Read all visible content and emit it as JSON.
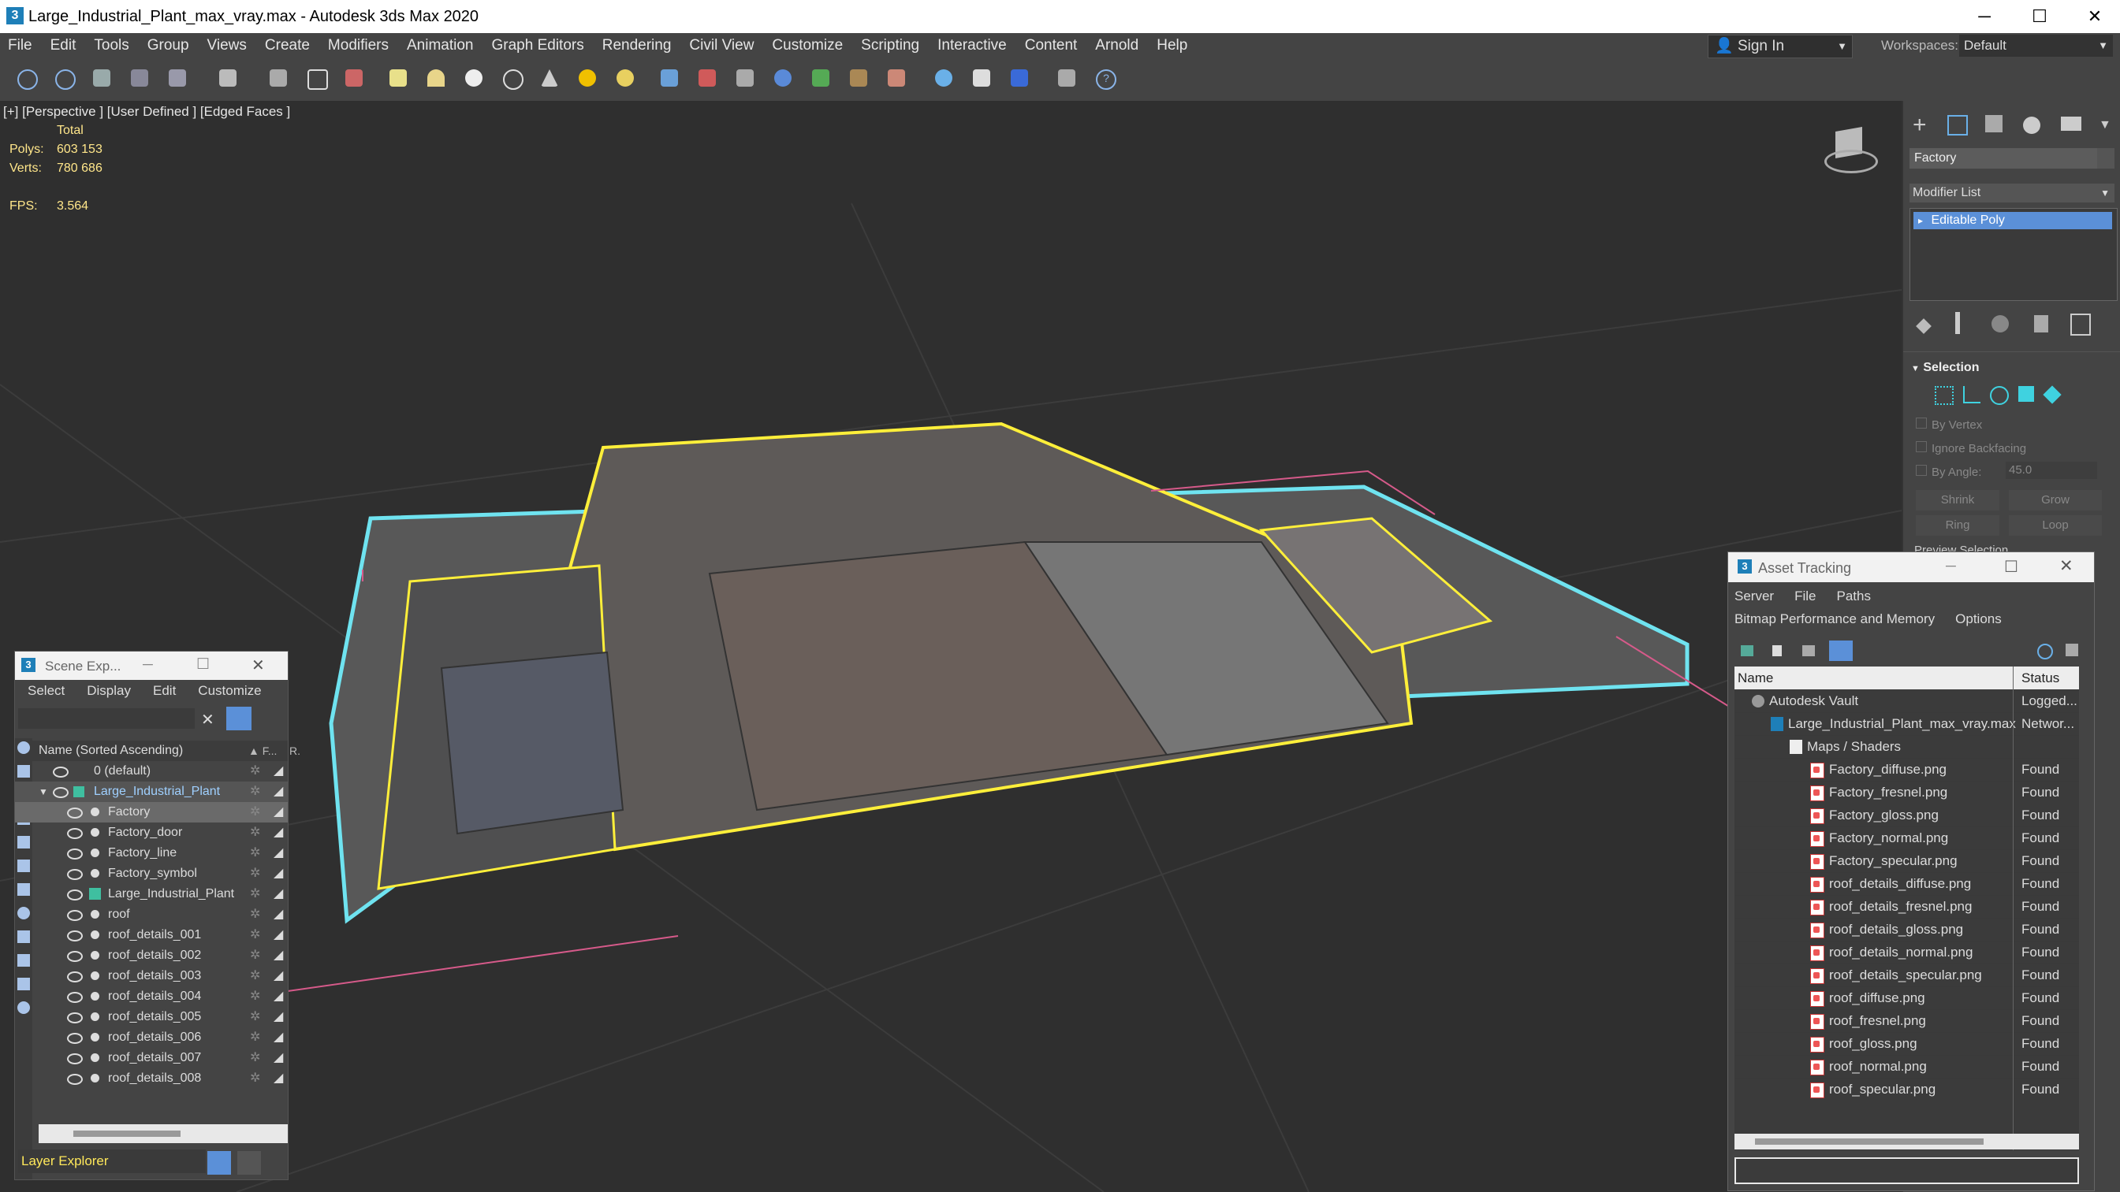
{
  "window": {
    "title": "Large_Industrial_Plant_max_vray.max - Autodesk 3ds Max 2020"
  },
  "menu": [
    "File",
    "Edit",
    "Tools",
    "Group",
    "Views",
    "Create",
    "Modifiers",
    "Animation",
    "Graph Editors",
    "Rendering",
    "Civil View",
    "Customize",
    "Scripting",
    "Interactive",
    "Content",
    "Arnold",
    "Help"
  ],
  "account": {
    "signin_label": "Sign In",
    "workspaces_label": "Workspaces:",
    "workspace_value": "Default"
  },
  "viewport": {
    "label": "[+] [Perspective ] [User Defined ] [Edged Faces ]",
    "total_label": "Total",
    "polys_label": "Polys:",
    "polys_value": "603 153",
    "verts_label": "Verts:",
    "verts_value": "780 686",
    "fps_label": "FPS:",
    "fps_value": "3.564"
  },
  "command_panel": {
    "object_name": "Factory",
    "modifier_list": "Modifier List",
    "stack_item": "Editable Poly",
    "selection_title": "Selection",
    "by_vertex": "By Vertex",
    "ignore_backfacing": "Ignore Backfacing",
    "by_angle": "By Angle:",
    "angle_value": "45.0",
    "shrink": "Shrink",
    "grow": "Grow",
    "ring": "Ring",
    "loop": "Loop",
    "preview_selection": "Preview Selection"
  },
  "scene_explorer": {
    "title": "Scene Exp...",
    "menu": [
      "Select",
      "Display",
      "Edit",
      "Customize"
    ],
    "column_name": "Name (Sorted Ascending)",
    "column_f": "▲ F...",
    "column_r": "R.",
    "layer_default": "0 (default)",
    "layer_plant": "Large_Industrial_Plant",
    "objects": [
      "Factory",
      "Factory_door",
      "Factory_line",
      "Factory_symbol",
      "Large_Industrial_Plant",
      "roof",
      "roof_details_001",
      "roof_details_002",
      "roof_details_003",
      "roof_details_004",
      "roof_details_005",
      "roof_details_006",
      "roof_details_007",
      "roof_details_008"
    ],
    "footer_label": "Layer Explorer"
  },
  "asset_tracking": {
    "title": "Asset Tracking",
    "menu": [
      "Server",
      "File",
      "Paths"
    ],
    "menu2": [
      "Bitmap Performance and Memory",
      "Options"
    ],
    "col_name": "Name",
    "col_status": "Status",
    "vault": {
      "name": "Autodesk Vault",
      "status": "Logged..."
    },
    "file": {
      "name": "Large_Industrial_Plant_max_vray.max",
      "status": "Networ..."
    },
    "maps_folder": "Maps / Shaders",
    "maps": [
      {
        "name": "Factory_diffuse.png",
        "status": "Found"
      },
      {
        "name": "Factory_fresnel.png",
        "status": "Found"
      },
      {
        "name": "Factory_gloss.png",
        "status": "Found"
      },
      {
        "name": "Factory_normal.png",
        "status": "Found"
      },
      {
        "name": "Factory_specular.png",
        "status": "Found"
      },
      {
        "name": "roof_details_diffuse.png",
        "status": "Found"
      },
      {
        "name": "roof_details_fresnel.png",
        "status": "Found"
      },
      {
        "name": "roof_details_gloss.png",
        "status": "Found"
      },
      {
        "name": "roof_details_normal.png",
        "status": "Found"
      },
      {
        "name": "roof_details_specular.png",
        "status": "Found"
      },
      {
        "name": "roof_diffuse.png",
        "status": "Found"
      },
      {
        "name": "roof_fresnel.png",
        "status": "Found"
      },
      {
        "name": "roof_gloss.png",
        "status": "Found"
      },
      {
        "name": "roof_normal.png",
        "status": "Found"
      },
      {
        "name": "roof_specular.png",
        "status": "Found"
      }
    ]
  }
}
